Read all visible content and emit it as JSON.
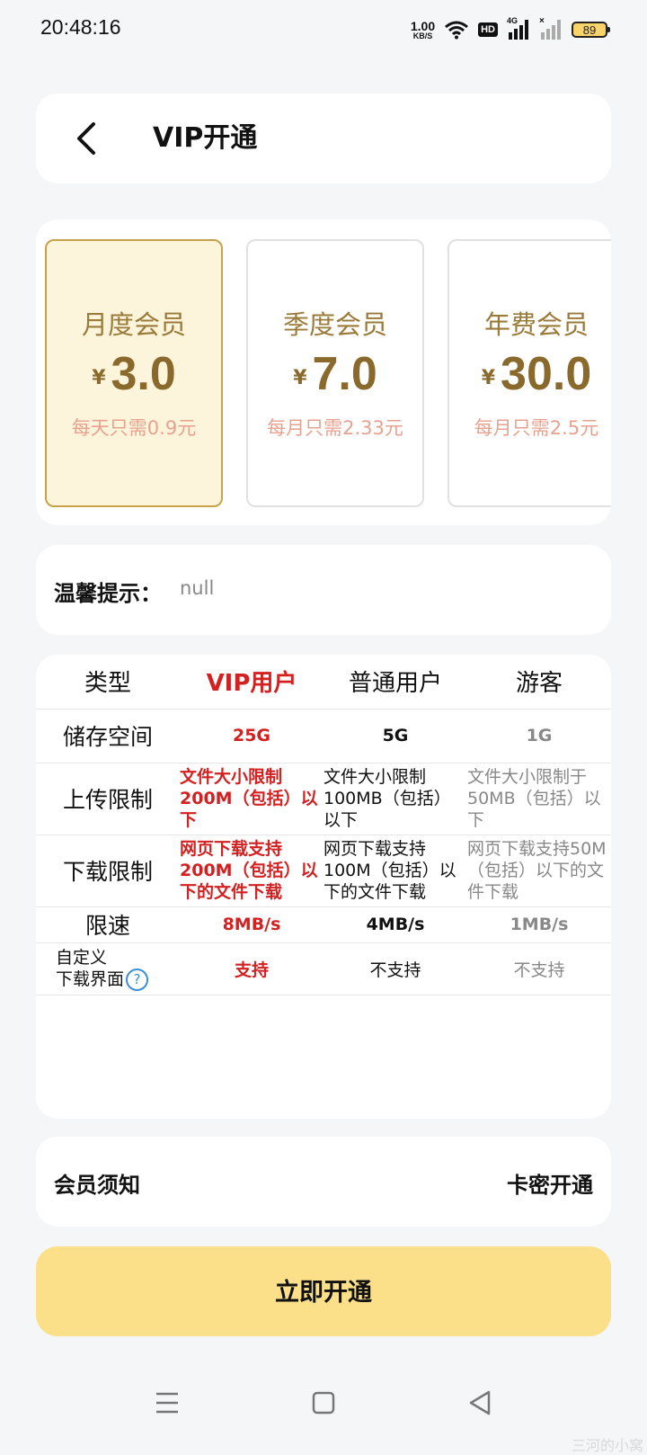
{
  "status_bar": {
    "time": "20:48:16",
    "net_speed_value": "1.00",
    "net_speed_unit": "KB/S",
    "hd_label": "HD",
    "network_label": "4G",
    "battery": "89"
  },
  "header": {
    "title": "VIP开通"
  },
  "plans": [
    {
      "name": "月度会员",
      "currency": "¥",
      "price": "3.0",
      "note": "每天只需0.9元",
      "selected": true
    },
    {
      "name": "季度会员",
      "currency": "¥",
      "price": "7.0",
      "note": "每月只需2.33元",
      "selected": false
    },
    {
      "name": "年费会员",
      "currency": "¥",
      "price": "30.0",
      "note": "每月只需2.5元",
      "selected": false
    }
  ],
  "tip": {
    "label": "温馨提示：",
    "value": "null"
  },
  "comparison": {
    "headers": [
      "类型",
      "VIP用户",
      "普通用户",
      "游客"
    ],
    "rows": [
      {
        "label": "储存空间",
        "vip": "25G",
        "normal": "5G",
        "guest": "1G"
      },
      {
        "label": "上传限制",
        "vip": "文件大小限制200M（包括）以下",
        "normal": "文件大小限制100MB（包括）以下",
        "guest": "文件大小限制于50MB（包括）以下"
      },
      {
        "label": "下载限制",
        "vip": "网页下载支持200M（包括）以下的文件下载",
        "normal": "网页下载支持100M（包括）以下的文件下载",
        "guest": "网页下载支持50M（包括）以下的文件下载"
      },
      {
        "label": "限速",
        "vip": "8MB/s",
        "normal": "4MB/s",
        "guest": "1MB/s"
      },
      {
        "label_line1": "自定义",
        "label_line2": "下载界面",
        "help": "?",
        "vip": "支持",
        "normal": "不支持",
        "guest": "不支持"
      }
    ]
  },
  "notice": {
    "left": "会员须知",
    "right": "卡密开通"
  },
  "cta": {
    "label": "立即开通"
  },
  "watermark": "三河的小窝",
  "colors": {
    "accent_gold": "#c8a24a",
    "vip_red": "#d32020",
    "cta_yellow": "#fbe089",
    "note_pink": "#e7a28f"
  }
}
